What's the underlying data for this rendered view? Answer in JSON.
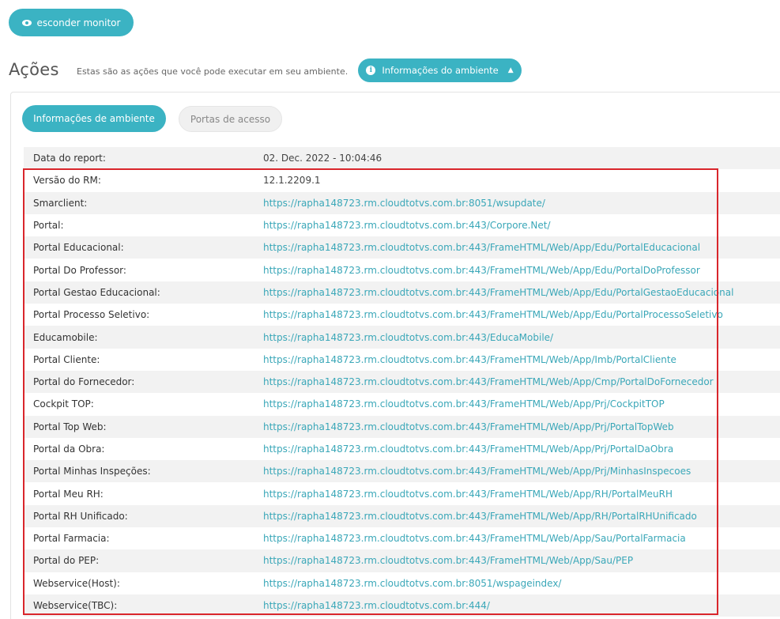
{
  "monitor_button": {
    "label": "esconder monitor",
    "icon": "eye-icon"
  },
  "header": {
    "title": "Ações",
    "description": "Estas são as ações que você pode executar em seu ambiente.",
    "env_info_button": "Informações do ambiente"
  },
  "tabs": [
    {
      "label": "Informações de ambiente",
      "active": true
    },
    {
      "label": "Portas de acesso",
      "active": false
    }
  ],
  "rows": [
    {
      "label": "Data do report:",
      "value": "02. Dec. 2022 - 10:04:46"
    },
    {
      "label": "Versão do RM:",
      "value": "12.1.2209.1"
    },
    {
      "label": "Smarclient:",
      "value": "https://rapha148723.rm.cloudtotvs.com.br:8051/wsupdate/"
    },
    {
      "label": "Portal:",
      "value": "https://rapha148723.rm.cloudtotvs.com.br:443/Corpore.Net/"
    },
    {
      "label": "Portal Educacional:",
      "value": "https://rapha148723.rm.cloudtotvs.com.br:443/FrameHTML/Web/App/Edu/PortalEducacional"
    },
    {
      "label": "Portal Do Professor:",
      "value": "https://rapha148723.rm.cloudtotvs.com.br:443/FrameHTML/Web/App/Edu/PortalDoProfessor"
    },
    {
      "label": "Portal Gestao Educacional:",
      "value": "https://rapha148723.rm.cloudtotvs.com.br:443/FrameHTML/Web/App/Edu/PortalGestaoEducacional"
    },
    {
      "label": "Portal Processo Seletivo:",
      "value": "https://rapha148723.rm.cloudtotvs.com.br:443/FrameHTML/Web/App/Edu/PortalProcessoSeletivo"
    },
    {
      "label": "Educamobile:",
      "value": "https://rapha148723.rm.cloudtotvs.com.br:443/EducaMobile/"
    },
    {
      "label": "Portal Cliente:",
      "value": "https://rapha148723.rm.cloudtotvs.com.br:443/FrameHTML/Web/App/Imb/PortalCliente"
    },
    {
      "label": "Portal do Fornecedor:",
      "value": "https://rapha148723.rm.cloudtotvs.com.br:443/FrameHTML/Web/App/Cmp/PortalDoFornecedor"
    },
    {
      "label": "Cockpit TOP:",
      "value": "https://rapha148723.rm.cloudtotvs.com.br:443/FrameHTML/Web/App/Prj/CockpitTOP"
    },
    {
      "label": "Portal Top Web:",
      "value": "https://rapha148723.rm.cloudtotvs.com.br:443/FrameHTML/Web/App/Prj/PortalTopWeb"
    },
    {
      "label": "Portal da Obra:",
      "value": "https://rapha148723.rm.cloudtotvs.com.br:443/FrameHTML/Web/App/Prj/PortalDaObra"
    },
    {
      "label": "Portal Minhas Inspeções:",
      "value": "https://rapha148723.rm.cloudtotvs.com.br:443/FrameHTML/Web/App/Prj/MinhasInspecoes"
    },
    {
      "label": "Portal Meu RH:",
      "value": "https://rapha148723.rm.cloudtotvs.com.br:443/FrameHTML/Web/App/RH/PortalMeuRH"
    },
    {
      "label": "Portal RH Unificado:",
      "value": "https://rapha148723.rm.cloudtotvs.com.br:443/FrameHTML/Web/App/RH/PortalRHUnificado"
    },
    {
      "label": "Portal Farmacia:",
      "value": "https://rapha148723.rm.cloudtotvs.com.br:443/FrameHTML/Web/App/Sau/PortalFarmacia"
    },
    {
      "label": "Portal do PEP:",
      "value": "https://rapha148723.rm.cloudtotvs.com.br:443/FrameHTML/Web/App/Sau/PEP"
    },
    {
      "label": "Webservice(Host):",
      "value": "https://rapha148723.rm.cloudtotvs.com.br:8051/wspageindex/"
    },
    {
      "label": "Webservice(TBC):",
      "value": "https://rapha148723.rm.cloudtotvs.com.br:444/"
    }
  ],
  "colors": {
    "accent": "#3bb3c3",
    "link": "#3aa7b8",
    "highlight": "#d9262c"
  }
}
